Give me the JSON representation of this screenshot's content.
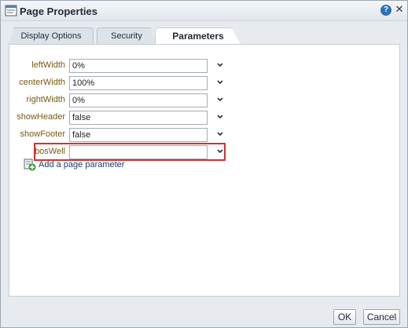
{
  "dialog": {
    "title": "Page Properties",
    "help_icon": "?",
    "close_icon": "✕"
  },
  "tabs": [
    {
      "label": "Display Options",
      "active": false
    },
    {
      "label": "Security",
      "active": false
    },
    {
      "label": "Parameters",
      "active": true
    }
  ],
  "parameters": [
    {
      "name": "leftWidth",
      "value": "0%"
    },
    {
      "name": "centerWidth",
      "value": "100%"
    },
    {
      "name": "rightWidth",
      "value": "0%"
    },
    {
      "name": "showHeader",
      "value": "false"
    },
    {
      "name": "showFooter",
      "value": "false"
    },
    {
      "name": "bosWell",
      "value": "",
      "highlighted": true
    }
  ],
  "add_parameter": {
    "label": "Add a page parameter",
    "icon": "add-parameter-icon"
  },
  "footer": {
    "ok_label": "OK",
    "cancel_label": "Cancel"
  },
  "colors": {
    "highlight": "#d5312e",
    "label": "#7a5a10",
    "link": "#1b3c6b"
  }
}
